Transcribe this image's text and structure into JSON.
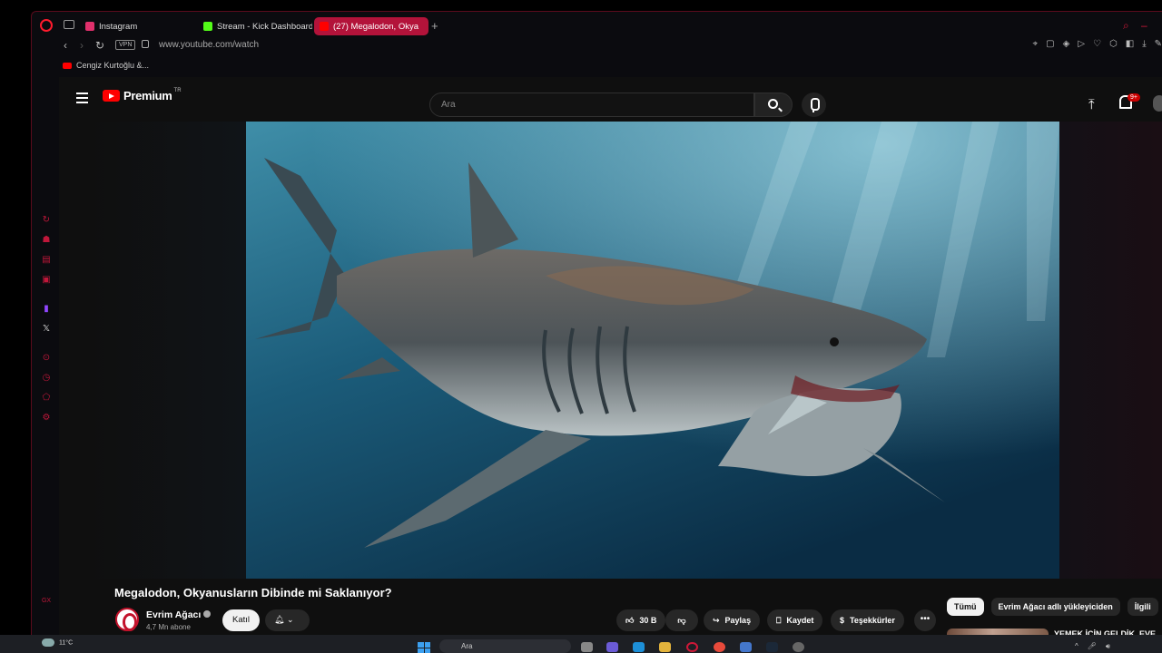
{
  "browser": {
    "tabs": [
      {
        "label": "Instagram",
        "color": "#e1306c"
      },
      {
        "label": "Stream - Kick Dashboard",
        "color": "#53fc18"
      },
      {
        "label": "(27) Megalodon, Okya",
        "color": "#ff0000",
        "active": true
      }
    ],
    "vpn_label": "VPN",
    "url": "www.youtube.com/watch",
    "bookmark": "Cengiz Kurtoğlu &...",
    "sidebar_icons": [
      "refresh-icon",
      "robot-icon",
      "chat-icon",
      "menu-icon",
      "twitch-icon",
      "x-icon",
      "player-icon",
      "history-icon",
      "extensions-icon",
      "settings-icon"
    ],
    "gx_label": "GX",
    "accent": "#b3133a"
  },
  "youtube": {
    "logo_text": "Premium",
    "logo_region": "TR",
    "search_placeholder": "Ara",
    "notification_badge": "9+",
    "video": {
      "title": "Megalodon, Okyanusların Dibinde mi Saklanıyor?",
      "channel": "Evrim Ağacı",
      "subscribers": "4,7 Mn abone",
      "join_label": "Katıl",
      "likes": "30 B",
      "share_label": "Paylaş",
      "save_label": "Kaydet",
      "thanks_label": "Teşekkürler"
    },
    "chips": [
      "Tümü",
      "Evrim Ağacı adlı yükleyiciden",
      "İlgili"
    ],
    "recommendation": {
      "title": "YEMEK İÇİN GELDİK, EVE ALMADILAR! ELBAEN, ERAY"
    }
  },
  "taskbar": {
    "temperature": "11°C",
    "search_label": "Ara"
  }
}
